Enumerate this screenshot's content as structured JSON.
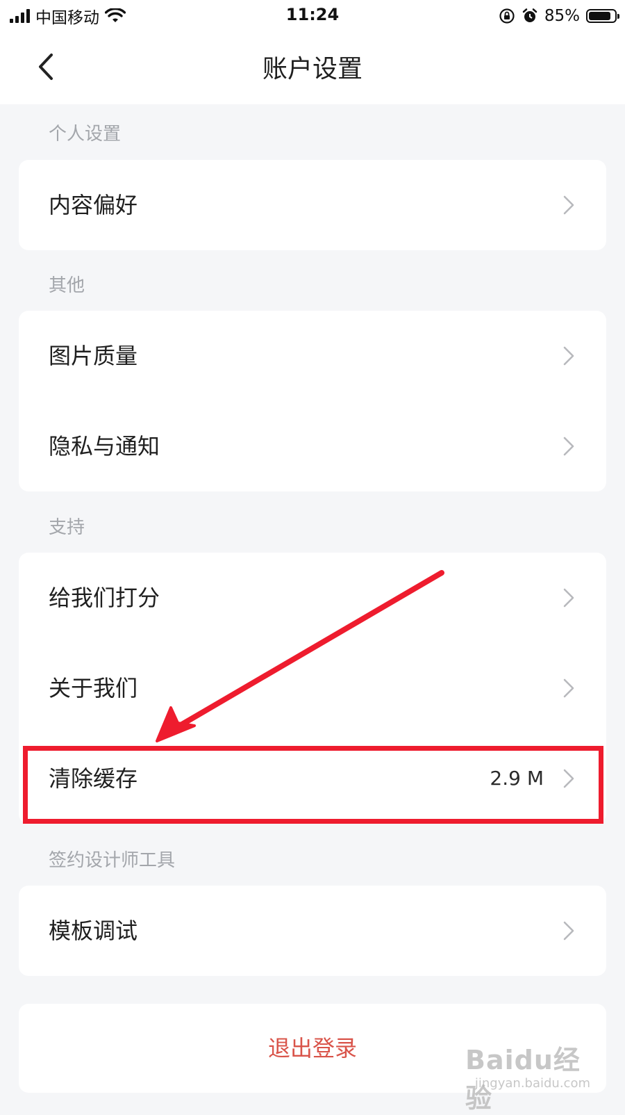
{
  "status_bar": {
    "carrier": "中国移动",
    "time": "11:24",
    "battery": "85%",
    "battery_level": 0.85
  },
  "nav": {
    "title": "账户设置"
  },
  "sections": [
    {
      "label": "个人设置",
      "items": [
        {
          "label": "内容偏好"
        }
      ]
    },
    {
      "label": "其他",
      "items": [
        {
          "label": "图片质量"
        },
        {
          "label": "隐私与通知"
        }
      ]
    },
    {
      "label": "支持",
      "items": [
        {
          "label": "给我们打分"
        },
        {
          "label": "关于我们"
        },
        {
          "label": "清除缓存",
          "value": "2.9 M"
        }
      ]
    },
    {
      "label": "签约设计师工具",
      "items": [
        {
          "label": "模板调试"
        }
      ]
    }
  ],
  "logout": {
    "label": "退出登录"
  },
  "annotation": {
    "highlight_color": "#ee1c2e"
  },
  "colors": {
    "logout": "#d9544a",
    "background": "#f5f6f8"
  },
  "watermark": {
    "brand": "Baidu经验",
    "url": "jingyan.baidu.com"
  }
}
